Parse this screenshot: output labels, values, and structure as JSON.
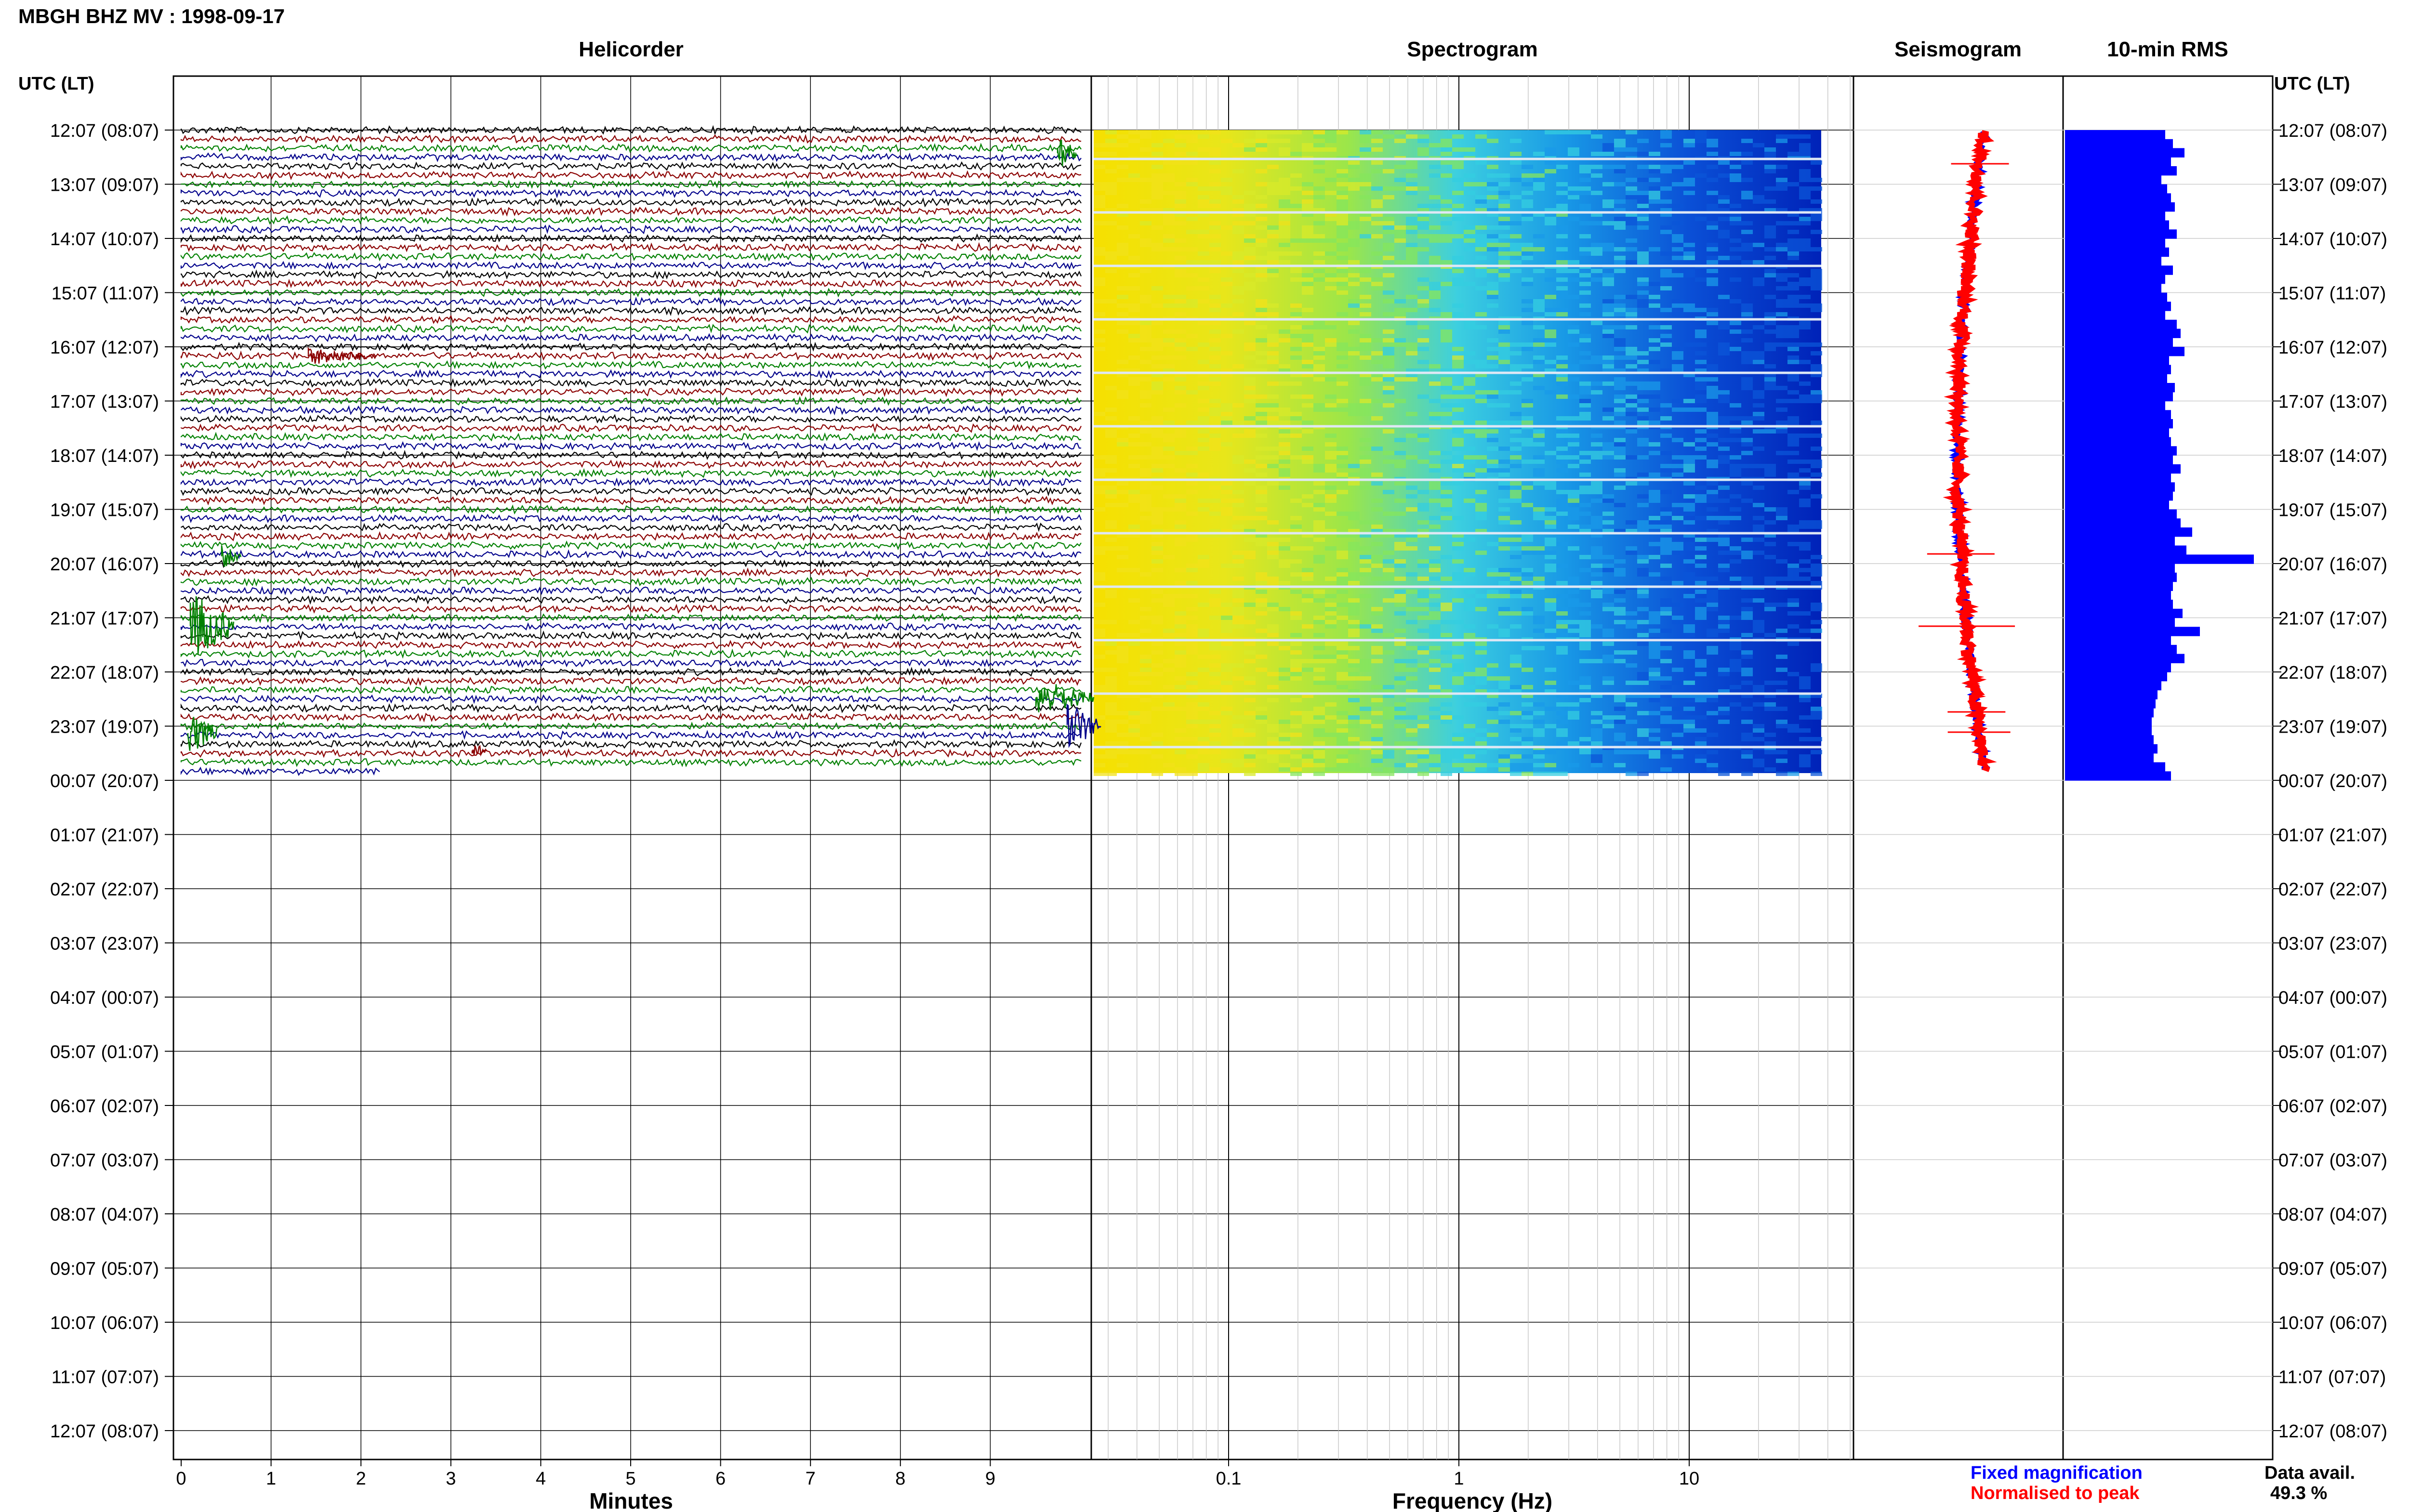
{
  "header": {
    "title": "MBGH BHZ MV : 1998-09-17",
    "utc_label_left": "UTC (LT)",
    "utc_label_right": "UTC (LT)"
  },
  "panels": {
    "helicorder": "Helicorder",
    "spectrogram": "Spectrogram",
    "seismogram": "Seismogram",
    "rms": "10-min RMS"
  },
  "axes": {
    "minutes_label": "Minutes",
    "frequency_label": "Frequency (Hz)",
    "minute_ticks": [
      "0",
      "1",
      "2",
      "3",
      "4",
      "5",
      "6",
      "7",
      "8",
      "9"
    ],
    "frequency_ticks": [
      "0.1",
      "1",
      "10"
    ],
    "time_labels": [
      "12:07 (08:07)",
      "13:07 (09:07)",
      "14:07 (10:07)",
      "15:07 (11:07)",
      "16:07 (12:07)",
      "17:07 (13:07)",
      "18:07 (14:07)",
      "19:07 (15:07)",
      "20:07 (16:07)",
      "21:07 (17:07)",
      "22:07 (18:07)",
      "23:07 (19:07)",
      "00:07 (20:07)",
      "01:07 (21:07)",
      "02:07 (22:07)",
      "03:07 (23:07)",
      "04:07 (00:07)",
      "05:07 (01:07)",
      "06:07 (02:07)",
      "07:07 (03:07)",
      "08:07 (04:07)",
      "09:07 (05:07)",
      "10:07 (06:07)",
      "11:07 (07:07)",
      "12:07 (08:07)"
    ]
  },
  "legend": {
    "fixed": "Fixed magnification",
    "normalised": "Normalised to peak",
    "fixed_color": "#0000ff",
    "normalised_color": "#ff0000"
  },
  "data_avail": {
    "label": "Data avail.",
    "value": "49.3 %"
  },
  "chart_data": {
    "type": "heatmap",
    "title": "MBGH BHZ MV : 1998-09-17",
    "trace_colors": [
      "#000000",
      "#8b0000",
      "#008000",
      "#00008b"
    ],
    "helicorder_minutes_xlim": [
      0,
      10
    ],
    "spectrogram_frequency_log_xlim": [
      0.02,
      50
    ],
    "data_hours_covered": 12,
    "rms_color": "#0000ff",
    "rms_relative_values": [
      0.52,
      0.56,
      0.62,
      0.55,
      0.58,
      0.5,
      0.53,
      0.55,
      0.57,
      0.52,
      0.54,
      0.58,
      0.52,
      0.54,
      0.5,
      0.56,
      0.52,
      0.5,
      0.53,
      0.55,
      0.52,
      0.58,
      0.6,
      0.56,
      0.62,
      0.54,
      0.55,
      0.53,
      0.57,
      0.56,
      0.52,
      0.55,
      0.56,
      0.54,
      0.55,
      0.58,
      0.56,
      0.6,
      0.55,
      0.57,
      0.56,
      0.54,
      0.58,
      0.6,
      0.66,
      0.57,
      0.63,
      0.98,
      0.57,
      0.58,
      0.56,
      0.55,
      0.56,
      0.61,
      0.57,
      0.7,
      0.55,
      0.58,
      0.62,
      0.55,
      0.53,
      0.5,
      0.48,
      0.47,
      0.46,
      0.45,
      0.45,
      0.46,
      0.48,
      0.46,
      0.52,
      0.55
    ]
  }
}
